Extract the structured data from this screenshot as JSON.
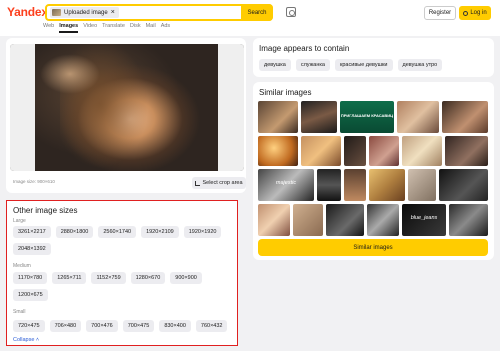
{
  "header": {
    "logo": "Yandex",
    "search_chip": "Uploaded image",
    "search_button": "Search",
    "register": "Register",
    "login": "Log in",
    "tabs": [
      "Web",
      "Images",
      "Video",
      "Translate",
      "Disk",
      "Mail",
      "Ads"
    ],
    "active_tab": "Images"
  },
  "image_panel": {
    "size_text": "Image size: 900×610",
    "crop_button": "Select crop area"
  },
  "sizes": {
    "title": "Other image sizes",
    "large_label": "Large",
    "large": [
      "3261×2217",
      "2880×1800",
      "2560×1740",
      "1920×2109",
      "1920×1920",
      "2048×1392"
    ],
    "medium_label": "Medium",
    "medium": [
      "1170×780",
      "1265×711",
      "1152×759",
      "1280×670",
      "900×900",
      "1200×675"
    ],
    "small_label": "Small",
    "small": [
      "720×475",
      "706×480",
      "700×476",
      "700×475",
      "830×400",
      "760×432"
    ],
    "collapse": "Collapse"
  },
  "contains": {
    "title": "Image appears to contain",
    "tags": [
      "девушка",
      "служанка",
      "красивые девушки",
      "девушка утро"
    ]
  },
  "similar": {
    "title": "Similar images",
    "button": "Similar images",
    "captions": {
      "green_banner": "ПРИГЛАШАЕМ КРАСАВИЦ",
      "majestic": "majestic",
      "blue_jeans": "blue_jeans"
    }
  }
}
